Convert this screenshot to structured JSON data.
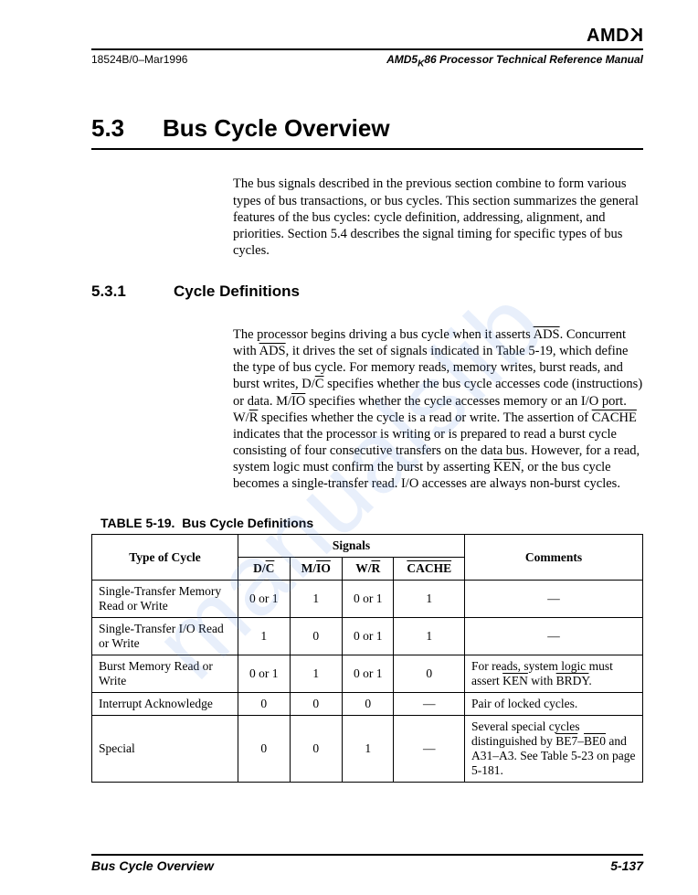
{
  "brand": "AMD",
  "header": {
    "doc_id": "18524B/0–Mar1996",
    "manual_title_pre": "AMD5",
    "manual_title_sub": "K",
    "manual_title_post": "86 Processor Technical Reference Manual"
  },
  "section": {
    "number": "5.3",
    "title": "Bus Cycle Overview"
  },
  "intro_paragraph": "The bus signals described in the previous section combine to form various types of bus transactions, or bus cycles. This section summarizes the general features of the bus cycles: cycle definition, addressing, alignment, and priorities. Section 5.4 describes the signal timing for specific types of bus cycles.",
  "subsection": {
    "number": "5.3.1",
    "title": "Cycle Definitions"
  },
  "cycle_paragraph_parts": [
    "The processor begins driving a bus cycle when it asserts ",
    "ADS",
    ". Concurrent with ",
    "ADS",
    ", it drives the set of signals indicated in Table 5-19, which define the type of bus cycle. For memory reads, memory writes, burst reads, and burst writes, D/",
    "C",
    " specifies whether the bus cycle accesses code (instructions) or data. M/",
    "IO",
    " specifies whether the cycle accesses memory or an I/O port. W/",
    "R",
    " specifies whether the cycle is a read or write. The assertion of ",
    "CACHE",
    " indicates that the processor is writing or is prepared to read a burst cycle consisting of four consecutive transfers on the data bus. However, for a read, system logic must confirm the burst by asserting ",
    "KEN",
    ", or the bus cycle becomes a single-transfer read. I/O accesses are always non-burst cycles."
  ],
  "table": {
    "label": "TABLE 5-19.",
    "caption": "Bus Cycle Definitions",
    "header": {
      "type": "Type of Cycle",
      "signals": "Signals",
      "dc_pre": "D/",
      "dc_over": "C",
      "mio_pre": "M/",
      "mio_over": "IO",
      "wr_pre": "W/",
      "wr_over": "R",
      "cache_over": "CACHE",
      "comments": "Comments"
    },
    "rows": [
      {
        "type": "Single-Transfer Memory Read or Write",
        "dc": "0 or 1",
        "mio": "1",
        "wr": "0 or 1",
        "cache": "1",
        "comment": "—"
      },
      {
        "type": "Single-Transfer I/O Read or Write",
        "dc": "1",
        "mio": "0",
        "wr": "0 or 1",
        "cache": "1",
        "comment": "—"
      },
      {
        "type": "Burst Memory Read or Write",
        "dc": "0 or 1",
        "mio": "1",
        "wr": "0 or 1",
        "cache": "0",
        "comment_parts": [
          "For reads, system logic must assert ",
          "KEN",
          " with ",
          "BRDY",
          "."
        ]
      },
      {
        "type": "Interrupt Acknowledge",
        "dc": "0",
        "mio": "0",
        "wr": "0",
        "cache": "—",
        "comment": "Pair of locked cycles."
      },
      {
        "type": "Special",
        "dc": "0",
        "mio": "0",
        "wr": "1",
        "cache": "—",
        "comment_parts": [
          "Several special cycles distinguished by ",
          "BE7",
          "–",
          "BE0",
          " and A31–A3. See Table 5-23 on page 5-181."
        ]
      }
    ]
  },
  "footer": {
    "left": "Bus Cycle Overview",
    "right": "5-137"
  },
  "watermark": "manualslib"
}
